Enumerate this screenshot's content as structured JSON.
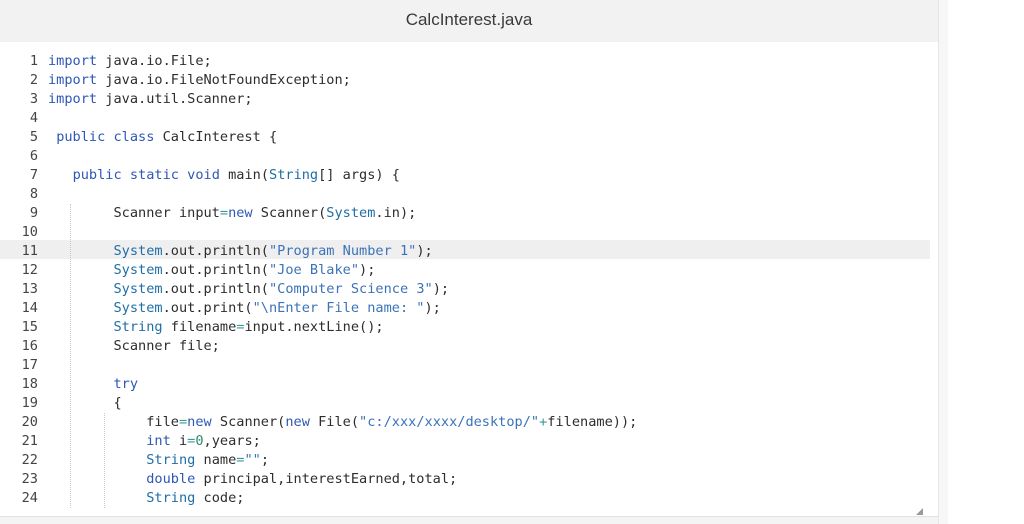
{
  "window": {
    "title": "CalcInterest.java"
  },
  "editor": {
    "current_line": 11,
    "lines": [
      {
        "n": "1",
        "tokens": [
          {
            "t": "import",
            "c": "kw"
          },
          {
            "t": " java.io.File;"
          }
        ]
      },
      {
        "n": "2",
        "tokens": [
          {
            "t": "import",
            "c": "kw"
          },
          {
            "t": " java.io.FileNotFoundException;"
          }
        ]
      },
      {
        "n": "3",
        "tokens": [
          {
            "t": "import",
            "c": "kw"
          },
          {
            "t": " java.util.Scanner;"
          }
        ]
      },
      {
        "n": "4",
        "tokens": []
      },
      {
        "n": "5",
        "tokens": [
          {
            "t": " "
          },
          {
            "t": "public",
            "c": "kw"
          },
          {
            "t": " "
          },
          {
            "t": "class",
            "c": "kw"
          },
          {
            "t": " CalcInterest {"
          }
        ]
      },
      {
        "n": "6",
        "tokens": []
      },
      {
        "n": "7",
        "tokens": [
          {
            "t": "   "
          },
          {
            "t": "public",
            "c": "kw"
          },
          {
            "t": " "
          },
          {
            "t": "static",
            "c": "kw"
          },
          {
            "t": " "
          },
          {
            "t": "void",
            "c": "kw"
          },
          {
            "t": " main("
          },
          {
            "t": "String",
            "c": "sys"
          },
          {
            "t": "[] args) {"
          }
        ]
      },
      {
        "n": "8",
        "tokens": []
      },
      {
        "n": "9",
        "tokens": [
          {
            "t": "        Scanner input"
          },
          {
            "t": "=",
            "c": "op"
          },
          {
            "t": "new",
            "c": "kw"
          },
          {
            "t": " Scanner("
          },
          {
            "t": "System",
            "c": "sys"
          },
          {
            "t": ".in);"
          }
        ]
      },
      {
        "n": "10",
        "tokens": []
      },
      {
        "n": "11",
        "tokens": [
          {
            "t": "        "
          },
          {
            "t": "System",
            "c": "sys"
          },
          {
            "t": ".out.println("
          },
          {
            "t": "\"Program Number 1\"",
            "c": "str"
          },
          {
            "t": ");"
          }
        ]
      },
      {
        "n": "12",
        "tokens": [
          {
            "t": "        "
          },
          {
            "t": "System",
            "c": "sys"
          },
          {
            "t": ".out.println("
          },
          {
            "t": "\"Joe Blake\"",
            "c": "str"
          },
          {
            "t": ");"
          }
        ]
      },
      {
        "n": "13",
        "tokens": [
          {
            "t": "        "
          },
          {
            "t": "System",
            "c": "sys"
          },
          {
            "t": ".out.println("
          },
          {
            "t": "\"Computer Science 3\"",
            "c": "str"
          },
          {
            "t": ");"
          }
        ]
      },
      {
        "n": "14",
        "tokens": [
          {
            "t": "        "
          },
          {
            "t": "System",
            "c": "sys"
          },
          {
            "t": ".out.print("
          },
          {
            "t": "\"\\nEnter File name: \"",
            "c": "str"
          },
          {
            "t": ");"
          }
        ]
      },
      {
        "n": "15",
        "tokens": [
          {
            "t": "        "
          },
          {
            "t": "String",
            "c": "sys"
          },
          {
            "t": " filename"
          },
          {
            "t": "=",
            "c": "op"
          },
          {
            "t": "input.nextLine();"
          }
        ]
      },
      {
        "n": "16",
        "tokens": [
          {
            "t": "        Scanner file;"
          }
        ]
      },
      {
        "n": "17",
        "tokens": []
      },
      {
        "n": "18",
        "tokens": [
          {
            "t": "        "
          },
          {
            "t": "try",
            "c": "kw"
          }
        ]
      },
      {
        "n": "19",
        "tokens": [
          {
            "t": "        {"
          }
        ]
      },
      {
        "n": "20",
        "tokens": [
          {
            "t": "            file"
          },
          {
            "t": "=",
            "c": "op"
          },
          {
            "t": "new",
            "c": "kw"
          },
          {
            "t": " Scanner("
          },
          {
            "t": "new",
            "c": "kw"
          },
          {
            "t": " File("
          },
          {
            "t": "\"c:/xxx/xxxx/desktop/\"",
            "c": "str"
          },
          {
            "t": "+",
            "c": "op"
          },
          {
            "t": "filename));"
          }
        ]
      },
      {
        "n": "21",
        "tokens": [
          {
            "t": "            "
          },
          {
            "t": "int",
            "c": "kw"
          },
          {
            "t": " i"
          },
          {
            "t": "=",
            "c": "op"
          },
          {
            "t": "0",
            "c": "num"
          },
          {
            "t": ",years;"
          }
        ]
      },
      {
        "n": "22",
        "tokens": [
          {
            "t": "            "
          },
          {
            "t": "String",
            "c": "sys"
          },
          {
            "t": " name"
          },
          {
            "t": "=",
            "c": "op"
          },
          {
            "t": "\"\"",
            "c": "str"
          },
          {
            "t": ";"
          }
        ]
      },
      {
        "n": "23",
        "tokens": [
          {
            "t": "            "
          },
          {
            "t": "double",
            "c": "kw"
          },
          {
            "t": " principal,interestEarned,total;"
          }
        ]
      },
      {
        "n": "24",
        "tokens": [
          {
            "t": "            "
          },
          {
            "t": "String",
            "c": "sys"
          },
          {
            "t": " code;"
          }
        ]
      }
    ]
  },
  "colors": {
    "keyword": "#2f57b5",
    "string": "#3b73b8",
    "system": "#1f6ea6",
    "number": "#2e8a6b",
    "operator": "#3a9a9a",
    "text": "#2d2d2d",
    "current_line_bg": "#efefef"
  },
  "icons": {
    "resize": "resize-grip-icon"
  }
}
